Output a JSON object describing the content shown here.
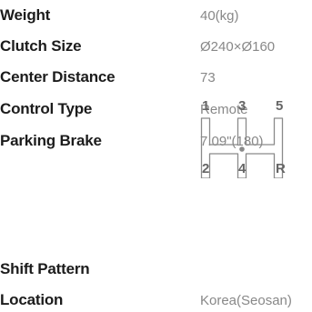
{
  "specs": [
    {
      "label": "Weight",
      "value": "40(kg)"
    },
    {
      "label": "Clutch Size",
      "value": "Ø240×Ø160"
    },
    {
      "label": "Center Distance",
      "value": "73"
    },
    {
      "label": "Control Type",
      "value": "Remote"
    },
    {
      "label": "Parking Brake",
      "value": "7.09\"(180)"
    },
    {
      "label": "Shift Pattern",
      "value": ""
    },
    {
      "label": "Location",
      "value": "Korea(Seosan)"
    }
  ],
  "shift_pattern": {
    "top_gears": [
      "1",
      "3",
      "5"
    ],
    "bottom_gears": [
      "2",
      "4",
      "R"
    ]
  }
}
